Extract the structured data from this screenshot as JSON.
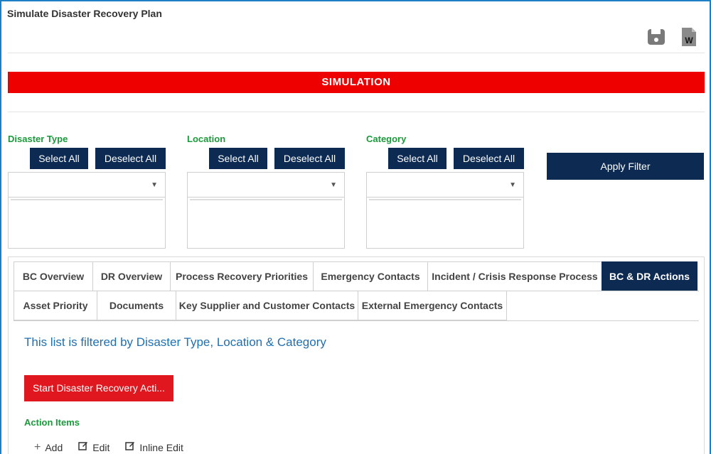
{
  "page": {
    "title": "Simulate Disaster Recovery Plan"
  },
  "header_icons": {
    "save": "save-icon",
    "word": "word-export-icon"
  },
  "banner": {
    "text": "SIMULATION",
    "color": "#ee0000"
  },
  "filters": [
    {
      "label": "Disaster Type",
      "select_all": "Select All",
      "deselect_all": "Deselect All",
      "value": ""
    },
    {
      "label": "Location",
      "select_all": "Select All",
      "deselect_all": "Deselect All",
      "value": ""
    },
    {
      "label": "Category",
      "select_all": "Select All",
      "deselect_all": "Deselect All",
      "value": ""
    }
  ],
  "apply_filter": "Apply Filter",
  "tabs": {
    "row1": [
      {
        "label": "BC Overview"
      },
      {
        "label": "DR Overview"
      },
      {
        "label": "Process Recovery Priorities"
      },
      {
        "label": "Emergency Contacts"
      },
      {
        "label": "Incident / Crisis Response Process"
      },
      {
        "label": "BC & DR Actions",
        "active": true
      }
    ],
    "row2": [
      {
        "label": "Asset Priority"
      },
      {
        "label": "Documents"
      },
      {
        "label": "Key Supplier and Customer Contacts"
      },
      {
        "label": "External Emergency Contacts"
      }
    ]
  },
  "content": {
    "filtered_note": "This list is filtered by Disaster Type, Location & Category",
    "start_button": "Start Disaster Recovery Acti...",
    "section_label": "Action Items",
    "toolbar": {
      "add": "Add",
      "edit": "Edit",
      "inline_edit": "Inline Edit"
    }
  },
  "colors": {
    "navy": "#0d2a52",
    "green_label": "#1a9a3a",
    "link_blue": "#1f6fb3",
    "start_red": "#e0171e"
  }
}
